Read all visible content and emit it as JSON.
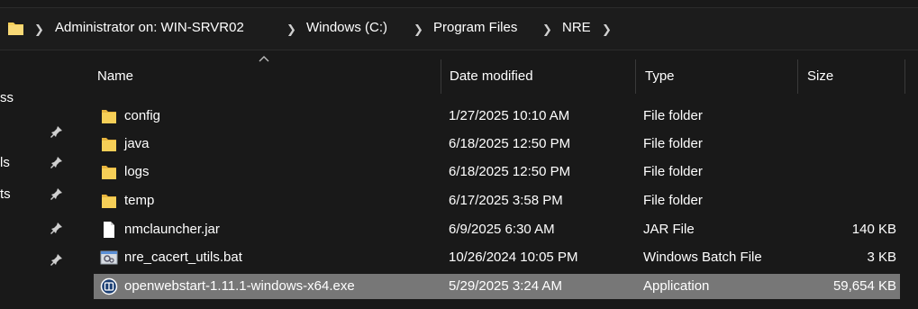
{
  "breadcrumb": {
    "items": [
      "Administrator on: WIN-SRVR02",
      "Windows (C:)",
      "Program Files",
      "NRE"
    ],
    "separator": ">"
  },
  "navpane": {
    "partial_labels": [
      "ss",
      "ls",
      "ts"
    ]
  },
  "columns": {
    "name": "Name",
    "date": "Date modified",
    "type": "Type",
    "size": "Size"
  },
  "files": [
    {
      "name": "config",
      "date": "1/27/2025 10:10 AM",
      "type": "File folder",
      "size": "",
      "icon": "folder-icon"
    },
    {
      "name": "java",
      "date": "6/18/2025 12:50 PM",
      "type": "File folder",
      "size": "",
      "icon": "folder-icon"
    },
    {
      "name": "logs",
      "date": "6/18/2025 12:50 PM",
      "type": "File folder",
      "size": "",
      "icon": "folder-icon"
    },
    {
      "name": "temp",
      "date": "6/17/2025 3:58 PM",
      "type": "File folder",
      "size": "",
      "icon": "folder-icon"
    },
    {
      "name": "nmclauncher.jar",
      "date": "6/9/2025 6:30 AM",
      "type": "JAR File",
      "size": "140 KB",
      "icon": "file-icon"
    },
    {
      "name": "nre_cacert_utils.bat",
      "date": "10/26/2024 10:05 PM",
      "type": "Windows Batch File",
      "size": "3 KB",
      "icon": "batch-file-icon"
    },
    {
      "name": "openwebstart-1.11.1-windows-x64.exe",
      "date": "5/29/2025 3:24 AM",
      "type": "Application",
      "size": "59,654 KB",
      "icon": "application-icon",
      "selected": true
    }
  ],
  "colors": {
    "background": "#191919",
    "selection": "#777777",
    "folder": "#f6cf57"
  }
}
